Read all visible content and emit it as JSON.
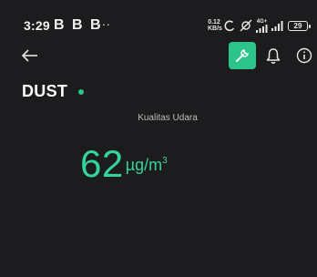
{
  "status_bar": {
    "time": "3:29",
    "notifications": "B B B",
    "more": "···",
    "net_speed_value": "0.12",
    "net_speed_unit": "KB/s",
    "network_label": "4G+",
    "battery": "29"
  },
  "colors": {
    "accent": "#2bc48a",
    "background": "#1c1c1e"
  },
  "icons": {
    "back": "arrow-left-icon",
    "settings": "wrench-icon",
    "notifications": "bell-icon",
    "info": "info-icon",
    "status_dot": "online-dot-icon"
  },
  "device": {
    "name": "DUST"
  },
  "main": {
    "quality_label": "Kualitas Udara",
    "value": "62",
    "unit": "µg/m",
    "unit_exponent": "3"
  }
}
